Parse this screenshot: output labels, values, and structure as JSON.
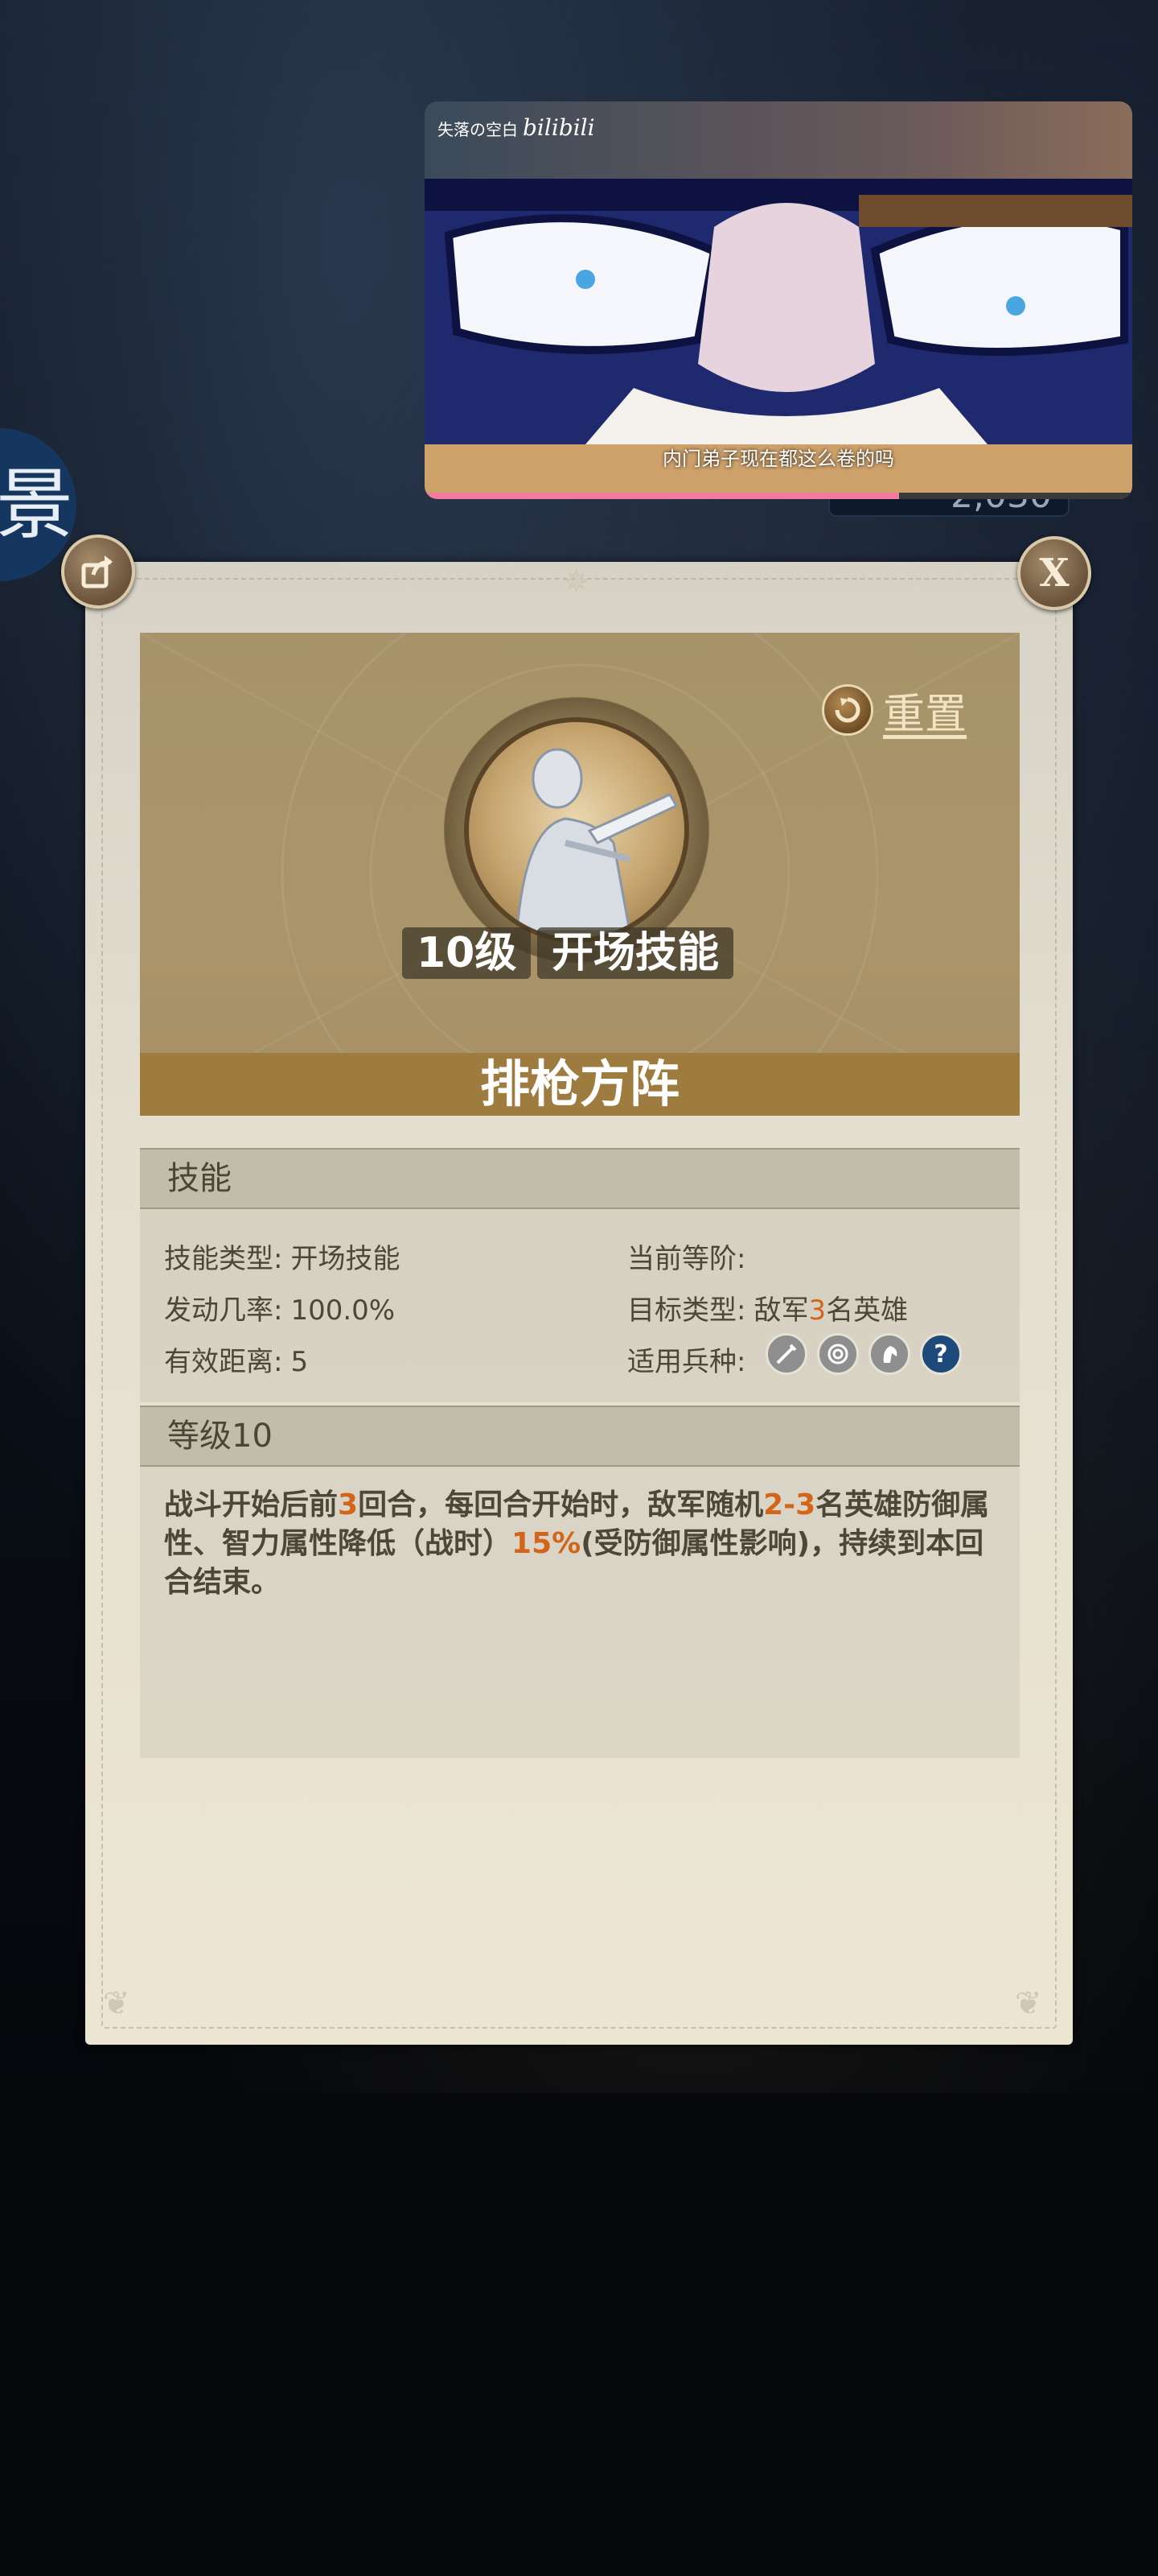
{
  "background": {
    "side_glyph": "景",
    "counter": "2,030"
  },
  "video": {
    "source_label": "失落の空白",
    "source_brand": "bilibili",
    "subtitle": "内门弟子现在都这么卷的吗",
    "progress": 0.67
  },
  "modal": {
    "share_icon": "share-icon",
    "close_label": "X",
    "reset_label": "重置",
    "level_badge": "10级",
    "type_badge": "开场技能",
    "skill_name": "排枪方阵",
    "section_skill": "技能",
    "info": {
      "skill_type_label": "技能类型:",
      "skill_type_value": "开场技能",
      "trigger_rate_label": "发动几率:",
      "trigger_rate_value": "100.0%",
      "range_label": "有效距离:",
      "range_value": "5",
      "current_tier_label": "当前等阶:",
      "current_tier_value": "",
      "target_type_label": "目标类型:",
      "target_type_prefix": "敌军",
      "target_type_num": "3",
      "target_type_suffix": "名英雄",
      "units_label": "适用兵种:"
    },
    "units": [
      "sword-unit-icon",
      "archer-unit-icon",
      "cavalry-unit-icon",
      "unknown-unit-icon"
    ],
    "section_level": "等级10",
    "description": {
      "p1": "战斗开始后前",
      "n1": "3",
      "p2": "回合，每回合开始时，敌军随机",
      "n2": "2-3",
      "p3": "名英雄防御属性、智力属性降低（战时）",
      "n3": "15%",
      "p4": "(受防御属性影响)，持续到本回合结束。"
    },
    "colors": {
      "highlight": "#d2651a",
      "name_bar": "#9e7c3f",
      "header_bg": "#a79369"
    }
  }
}
